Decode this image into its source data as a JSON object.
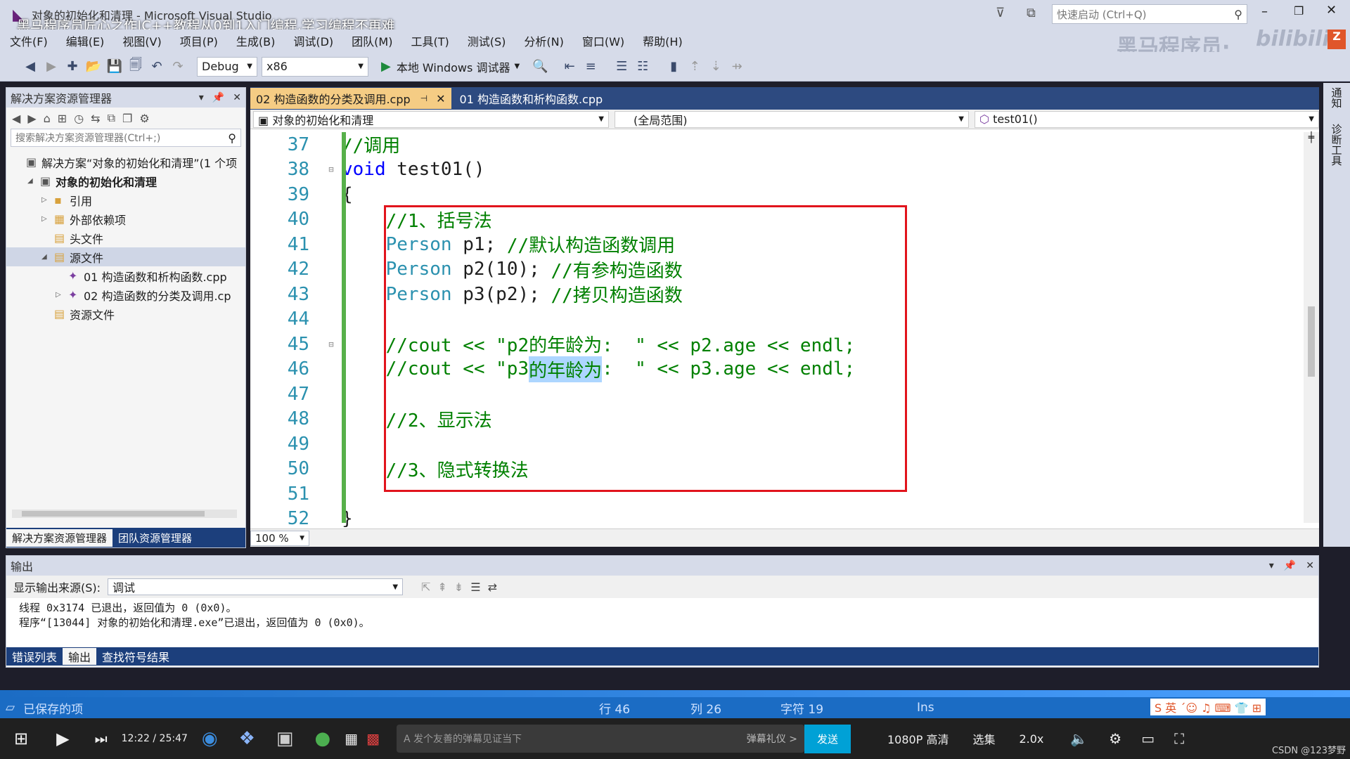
{
  "window": {
    "title": "对象的初始化和清理 - Microsoft Visual Studio",
    "overlay_title": "黑马程序员匠心之作|C++教程从0到1入门编程,学习编程不再难",
    "quick_launch_placeholder": "快速启动 (Ctrl+Q)",
    "watermark": "黑马程序员·",
    "bilibili_logo": "bilibili"
  },
  "menu": [
    "文件(F)",
    "编辑(E)",
    "视图(V)",
    "项目(P)",
    "生成(B)",
    "调试(D)",
    "团队(M)",
    "工具(T)",
    "测试(S)",
    "分析(N)",
    "窗口(W)",
    "帮助(H)"
  ],
  "toolbar": {
    "config": "Debug",
    "platform": "x86",
    "run_label": "本地 Windows 调试器"
  },
  "solution_explorer": {
    "title": "解决方案资源管理器",
    "search_placeholder": "搜索解决方案资源管理器(Ctrl+;)",
    "items": [
      {
        "label": "解决方案“对象的初始化和清理”(1 个项",
        "indent": 0
      },
      {
        "label": "对象的初始化和清理",
        "indent": 1,
        "bold": true
      },
      {
        "label": "引用",
        "indent": 2
      },
      {
        "label": "外部依赖项",
        "indent": 2
      },
      {
        "label": "头文件",
        "indent": 2
      },
      {
        "label": "源文件",
        "indent": 2,
        "selected": true
      },
      {
        "label": "01 构造函数和析构函数.cpp",
        "indent": 3
      },
      {
        "label": "02 构造函数的分类及调用.cp",
        "indent": 3
      },
      {
        "label": "资源文件",
        "indent": 2
      }
    ],
    "tabs": [
      "解决方案资源管理器",
      "团队资源管理器"
    ]
  },
  "editor": {
    "tabs": [
      {
        "label": "02 构造函数的分类及调用.cpp",
        "active": true
      },
      {
        "label": "01 构造函数和析构函数.cpp",
        "active": false
      }
    ],
    "nav_project": "对象的初始化和清理",
    "nav_scope": "(全局范围)",
    "nav_function": "test01()",
    "zoom": "100 %",
    "lines": [
      {
        "n": "37",
        "segs": [
          {
            "c": "cm",
            "t": "//调用"
          }
        ]
      },
      {
        "n": "38",
        "segs": [
          {
            "c": "kw",
            "t": "void"
          },
          {
            "c": "",
            "t": " test01()"
          }
        ]
      },
      {
        "n": "39",
        "segs": [
          {
            "c": "",
            "t": "{"
          }
        ]
      },
      {
        "n": "40",
        "segs": [
          {
            "c": "",
            "t": "    "
          },
          {
            "c": "cm",
            "t": "//1、括号法"
          }
        ]
      },
      {
        "n": "41",
        "segs": [
          {
            "c": "",
            "t": "    "
          },
          {
            "c": "ty",
            "t": "Person"
          },
          {
            "c": "",
            "t": " p1; "
          },
          {
            "c": "cm",
            "t": "//默认构造函数调用"
          }
        ]
      },
      {
        "n": "42",
        "segs": [
          {
            "c": "",
            "t": "    "
          },
          {
            "c": "ty",
            "t": "Person"
          },
          {
            "c": "",
            "t": " p2(10); "
          },
          {
            "c": "cm",
            "t": "//有参构造函数"
          }
        ]
      },
      {
        "n": "43",
        "segs": [
          {
            "c": "",
            "t": "    "
          },
          {
            "c": "ty",
            "t": "Person"
          },
          {
            "c": "",
            "t": " p3(p2); "
          },
          {
            "c": "cm",
            "t": "//拷贝构造函数"
          }
        ]
      },
      {
        "n": "44",
        "segs": []
      },
      {
        "n": "45",
        "segs": [
          {
            "c": "",
            "t": "    "
          },
          {
            "c": "cm",
            "t": "//cout << \"p2的年龄为:  \" << p2.age << endl;"
          }
        ]
      },
      {
        "n": "46",
        "segs": [
          {
            "c": "",
            "t": "    "
          },
          {
            "c": "cm",
            "t": "//cout << \"p3"
          },
          {
            "c": "cm sel",
            "t": "的年龄为"
          },
          {
            "c": "cm",
            "t": ":  \" << p3.age << endl;"
          }
        ]
      },
      {
        "n": "47",
        "segs": []
      },
      {
        "n": "48",
        "segs": [
          {
            "c": "",
            "t": "    "
          },
          {
            "c": "cm",
            "t": "//2、显示法"
          }
        ]
      },
      {
        "n": "49",
        "segs": []
      },
      {
        "n": "50",
        "segs": [
          {
            "c": "",
            "t": "    "
          },
          {
            "c": "cm",
            "t": "//3、隐式转换法"
          }
        ]
      },
      {
        "n": "51",
        "segs": []
      },
      {
        "n": "52",
        "segs": [
          {
            "c": "",
            "t": "}"
          }
        ]
      }
    ]
  },
  "output": {
    "title": "输出",
    "source_label": "显示输出来源(S):",
    "source_value": "调试",
    "lines": [
      "线程 0x3174 已退出，返回值为 0 (0x0)。",
      "程序“[13044] 对象的初始化和清理.exe”已退出，返回值为 0 (0x0)。"
    ],
    "tabs": [
      "错误列表",
      "输出",
      "查找符号结果"
    ]
  },
  "statusbar": {
    "left": "已保存的项",
    "line": "行 46",
    "col": "列 26",
    "char": "字符 19",
    "mode": "Ins"
  },
  "player": {
    "time": "12:22 / 25:47",
    "danmaku_placeholder": "发个友善的弹幕见证当下",
    "danmaku_etiquette": "弹幕礼仪 >",
    "send": "发送",
    "quality": "1080P 高清",
    "episodes": "选集",
    "speed": "2.0x",
    "csdn": "CSDN @123梦野"
  },
  "right_rail": [
    "通知",
    "诊断工具"
  ]
}
